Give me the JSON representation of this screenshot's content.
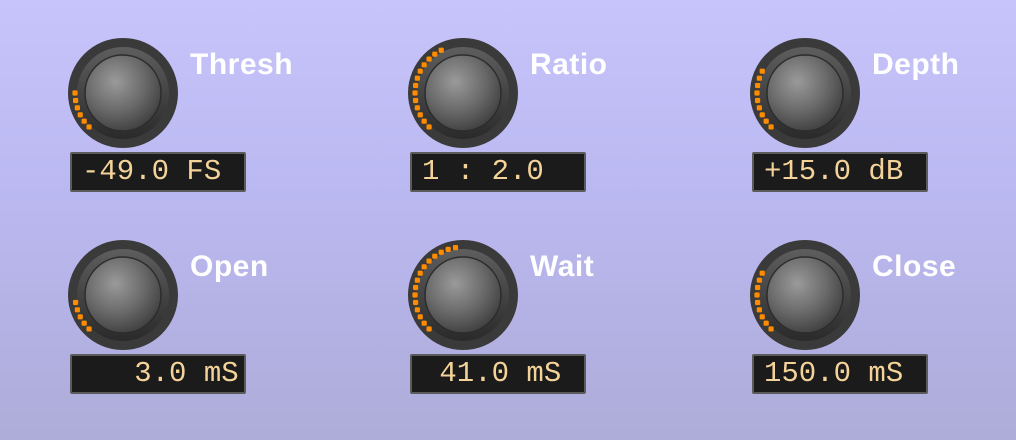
{
  "colors": {
    "accent_dot": "#ff8c00",
    "label": "#ffffff",
    "readout_text": "#f4d39a",
    "readout_bg": "#1b1b1b"
  },
  "knobs": [
    {
      "label": "Thresh",
      "value": "-49.0 FS",
      "level": 0.18
    },
    {
      "label": "Ratio",
      "value": "1 : 2.0",
      "level": 0.4
    },
    {
      "label": "Depth",
      "value": "+15.0 dB",
      "level": 0.28
    },
    {
      "label": "Open",
      "value": "   3.0 mS",
      "level": 0.13
    },
    {
      "label": "Wait",
      "value": " 41.0 mS",
      "level": 0.45
    },
    {
      "label": "Close",
      "value": "150.0 mS",
      "level": 0.26
    }
  ]
}
